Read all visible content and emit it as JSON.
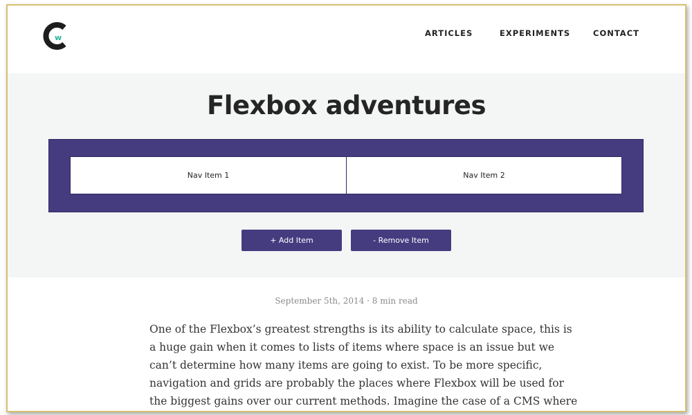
{
  "header": {
    "logo": {
      "letters": "C",
      "sub_letter": "w",
      "primary_color": "#1e1e1e",
      "accent_color": "#2bb59a"
    },
    "nav": [
      {
        "label": "ARTICLES"
      },
      {
        "label": "EXPERIMENTS"
      },
      {
        "label": "CONTACT"
      }
    ]
  },
  "hero": {
    "title": "Flexbox adventures",
    "accent_color": "#453c80",
    "nav_items": [
      "Nav Item 1",
      "Nav Item 2"
    ],
    "add_button": "+ Add Item",
    "remove_button": "- Remove Item"
  },
  "article": {
    "meta": "September 5th, 2014 · 8 min read",
    "lines": [
      "One of the Flexbox’s greatest strengths is its ability to calculate space, this is",
      "a huge gain when it comes to lists of items where space is an issue but we",
      "can’t determine how many items are going to exist. To be more specific,",
      "navigation and grids are probably the places where Flexbox will be used for",
      "the biggest gains over our current methods. Imagine the case of a CMS where"
    ]
  }
}
